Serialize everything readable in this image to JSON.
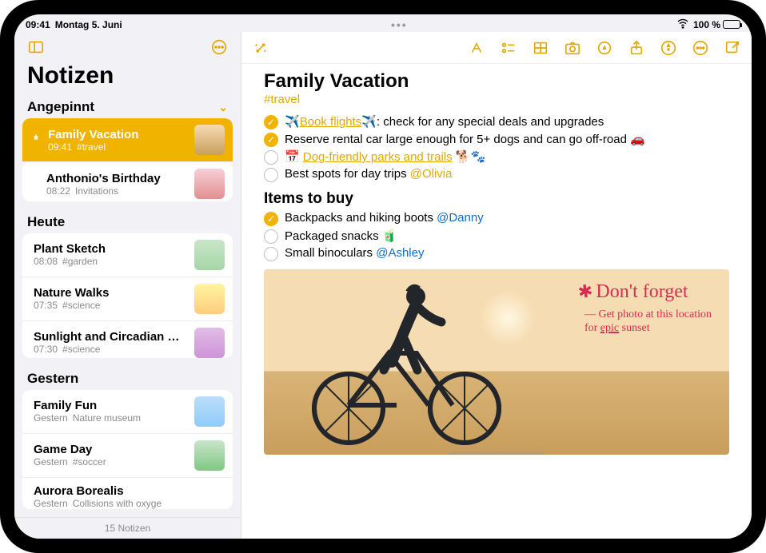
{
  "status": {
    "time": "09:41",
    "date": "Montag 5. Juni",
    "battery": "100 %"
  },
  "sidebar": {
    "title": "Notizen",
    "footer": "15 Notizen",
    "sections": [
      {
        "label": "Angepinnt",
        "items": [
          {
            "title": "Family Vacation",
            "time": "09:41",
            "snippet": "#travel"
          },
          {
            "title": "Anthonio's Birthday",
            "time": "08:22",
            "snippet": "Invitations"
          }
        ]
      },
      {
        "label": "Heute",
        "items": [
          {
            "title": "Plant Sketch",
            "time": "08:08",
            "snippet": "#garden"
          },
          {
            "title": "Nature Walks",
            "time": "07:35",
            "snippet": "#science"
          },
          {
            "title": "Sunlight and Circadian Rhy...",
            "time": "07:30",
            "snippet": "#science"
          }
        ]
      },
      {
        "label": "Gestern",
        "items": [
          {
            "title": "Family Fun",
            "time": "Gestern",
            "snippet": "Nature museum"
          },
          {
            "title": "Game Day",
            "time": "Gestern",
            "snippet": "#soccer"
          },
          {
            "title": "Aurora Borealis",
            "time": "Gestern",
            "snippet": "Collisions with oxyge"
          }
        ]
      }
    ]
  },
  "note": {
    "title": "Family Vacation",
    "tag": "#travel",
    "checklist1": [
      {
        "checked": true,
        "pre": "✈️",
        "link": "Book flights",
        "post": "✈️: check for any special deals and upgrades"
      },
      {
        "checked": true,
        "text": "Reserve rental car large enough for 5+ dogs and can go off-road 🚗"
      },
      {
        "checked": false,
        "cal": true,
        "link": "Dog-friendly parks and trails",
        "post": " 🐕🐾"
      },
      {
        "checked": false,
        "text": "Best spots for day trips ",
        "mention": "@Olivia"
      }
    ],
    "section2": "Items to buy",
    "checklist2": [
      {
        "checked": true,
        "text": "Backpacks and hiking boots ",
        "mentionBlue": "@Danny"
      },
      {
        "checked": false,
        "text": "Packaged snacks 🧃"
      },
      {
        "checked": false,
        "text": "Small binoculars ",
        "mentionBlue": "@Ashley"
      }
    ],
    "handwriting": {
      "title": "Don't forget",
      "line1": "— Get photo at this location",
      "line2": "for epic sunset"
    }
  }
}
